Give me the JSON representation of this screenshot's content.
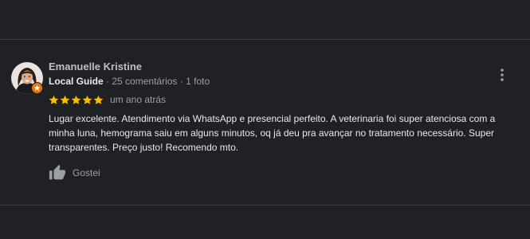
{
  "review": {
    "author_name": "Emanuelle Kristine",
    "local_guide_label": "Local Guide",
    "reviews_count": "25 comentários",
    "separator": "·",
    "photos_count": "1 foto",
    "rating": 5,
    "time_ago": "um ano atrás",
    "text": "Lugar excelente.  Atendimento via WhatsApp e presencial  perfeito.  A veterinaria foi super atenciosa com a minha luna, hemograma saiu em alguns minutos, oq já deu pra avançar no tratamento necessário. Super transparentes. Preço justo! Recomendo mto.",
    "like_label": "Gostei"
  },
  "icons": {
    "avatar": "avatar",
    "guide_badge": "local-guide-badge-icon",
    "star": "star-icon",
    "menu": "more-vert-icon",
    "like": "thumbs-up-icon"
  },
  "colors": {
    "background": "#202124",
    "star": "#fbbc04",
    "badge": "#e8710a",
    "text_primary": "#e8eaed",
    "text_secondary": "#9aa0a6"
  }
}
